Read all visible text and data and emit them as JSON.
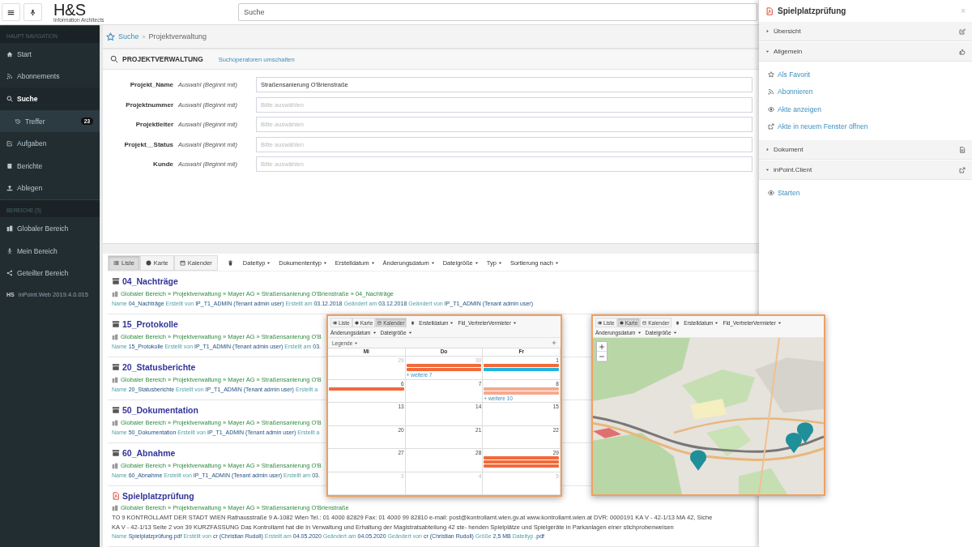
{
  "header": {
    "logo": "H&S",
    "logo_subtitle": "Information Architects",
    "search_placeholder": "Suche"
  },
  "sidebar": {
    "sections": [
      {
        "title": "HAUPT NAVIGATION",
        "items": [
          {
            "label": "Start",
            "selected": false
          },
          {
            "label": "Abonnements",
            "selected": false
          },
          {
            "label": "Suche",
            "selected": true,
            "children": [
              {
                "label": "Treffer",
                "selected": false,
                "badge": "23"
              }
            ]
          },
          {
            "label": "Aufgaben",
            "selected": false
          },
          {
            "label": "Berichte",
            "selected": false
          },
          {
            "label": "Ablegen",
            "selected": false
          }
        ]
      },
      {
        "title": "BEREICHE (5)",
        "items": [
          {
            "label": "Globaler Bereich",
            "selected": false
          },
          {
            "label": "Mein Bereich",
            "selected": false
          },
          {
            "label": "Geteilter Bereich",
            "selected": false
          }
        ]
      }
    ],
    "footer_logo": "HS",
    "version": "inPoint.Web 2019.4.0.015"
  },
  "breadcrumb": {
    "link": "Suche",
    "separator": "»",
    "current": "Projektverwaltung"
  },
  "search_panel": {
    "title": "PROJEKTVERWALTUNG",
    "toggle_link": "Suchoperatoren umschalten",
    "fields": [
      {
        "label": "Projekt_Name",
        "operator": "Auswahl (Beginnt mit)",
        "value": "Straßensanierung O'Brienstraße"
      },
      {
        "label": "Projektnummer",
        "operator": "Auswahl (Beginnt mit)",
        "placeholder": "Bitte auswählen"
      },
      {
        "label": "Projektleiter",
        "operator": "Auswahl (Beginnt mit)",
        "placeholder": "Bitte auswählen"
      },
      {
        "label": "Projekt__Status",
        "operator": "Auswahl (Beginnt mit)",
        "placeholder": "Bitte auswählen"
      },
      {
        "label": "Kunde",
        "operator": "Auswahl (Beginnt mit)",
        "placeholder": "Bitte auswählen"
      }
    ]
  },
  "results_toolbar": {
    "views": [
      {
        "label": "Liste",
        "selected": true
      },
      {
        "label": "Karte",
        "selected": false
      },
      {
        "label": "Kalender",
        "selected": false
      }
    ],
    "filters": [
      "Dateityp",
      "Dokumententyp",
      "Erstelldatum",
      "Änderungsdatum",
      "Dateigröße",
      "Typ",
      "Sortierung nach"
    ]
  },
  "results": [
    {
      "kind": "folder",
      "title": "04_Nachträge",
      "path": "Globaler Bereich » Projektverwaltung » Mayer AG » Straßensanierung O'Brienstraße » 04_Nachträge",
      "meta": [
        {
          "key": "Name",
          "value": "04_Nachträge"
        },
        {
          "key": "Erstellt von",
          "value": "IP_T1_ADMIN (Tenant admin user)"
        },
        {
          "key": "Erstellt am",
          "value": "03.12.2018"
        },
        {
          "key": "Geändert am",
          "value": "03.12.2018"
        },
        {
          "key": "Geändert von",
          "value": "IP_T1_ADMIN (Tenant admin user)"
        }
      ]
    },
    {
      "kind": "folder",
      "title": "15_Protokolle",
      "path": "Globaler Bereich » Projektverwaltung » Mayer AG » Straßensanierung O'B",
      "meta": [
        {
          "key": "Name",
          "value": "15_Protokolle"
        },
        {
          "key": "Erstellt von",
          "value": "IP_T1_ADMIN (Tenant admin user)"
        },
        {
          "key": "Erstellt am",
          "value": "03."
        }
      ]
    },
    {
      "kind": "folder",
      "title": "20_Statusberichte",
      "path": "Globaler Bereich » Projektverwaltung » Mayer AG » Straßensanierung O'B",
      "meta": [
        {
          "key": "Name",
          "value": "20_Statusberichte"
        },
        {
          "key": "Erstellt von",
          "value": "IP_T1_ADMIN (Tenant admin user)"
        },
        {
          "key": "Erstellt a"
        }
      ]
    },
    {
      "kind": "folder",
      "title": "50_Dokumentation",
      "path": "Globaler Bereich » Projektverwaltung » Mayer AG » Straßensanierung O'B",
      "meta": [
        {
          "key": "Name",
          "value": "50_Dokumentation"
        },
        {
          "key": "Erstellt von",
          "value": "IP_T1_ADMIN (Tenant admin user)"
        },
        {
          "key": "Erstellt a"
        }
      ]
    },
    {
      "kind": "folder",
      "title": "60_Abnahme",
      "path": "Globaler Bereich » Projektverwaltung » Mayer AG » Straßensanierung O'B",
      "meta": [
        {
          "key": "Name",
          "value": "60_Abnahme"
        },
        {
          "key": "Erstellt von",
          "value": "IP_T1_ADMIN (Tenant admin user)"
        },
        {
          "key": "Erstellt am",
          "value": "03."
        }
      ]
    },
    {
      "kind": "pdf",
      "title": "Spielplatzprüfung",
      "path": "Globaler Bereich » Projektverwaltung » Mayer AG » Straßensanierung O'Brienstraße",
      "snippet_lines": [
        "TO 9 KONTROLLAMT DER STADT WIEN Rathausstraße 9 A-1082 Wien Tel.: 01 4000 82829 Fax: 01 4000 99 82810 e-mail: post@kontrollamt.wien.gv.at www.kontrollamt.wien.at DVR: 0000191 KA V - 42-1/13 MA 42, Siche",
        "KA V - 42-1/13 Seite 2 von 39 KURZFASSUNG Das Kontrollamt hat die in Verwaltung und Erhaltung der Magistratsabteilung 42 ste- henden Spielplätze und Spielgeräte in Parkanlagen einer stichprobenweisen"
      ],
      "meta": [
        {
          "key": "Name",
          "value": "Spielplatzprüfung.pdf"
        },
        {
          "key": "Erstellt von",
          "value": "cr (Christian Rudoll)"
        },
        {
          "key": "Erstellt am",
          "value": "04.05.2020"
        },
        {
          "key": "Geändert am",
          "value": "04.05.2020"
        },
        {
          "key": "Geändert von",
          "value": "cr (Christian Rudoll)"
        },
        {
          "key": "Größe",
          "value": "2,5 MB"
        },
        {
          "key": "Dateityp",
          "value": ".pdf"
        }
      ]
    }
  ],
  "calendar_preview": {
    "views": [
      {
        "label": "Liste",
        "selected": false
      },
      {
        "label": "Karte",
        "selected": false
      },
      {
        "label": "Kalender",
        "selected": true
      }
    ],
    "filters": [
      "Erstelldatum",
      "Fld_VertreterVermieter",
      "Änderungsdatum",
      "Dateigröße"
    ],
    "legend": "Legende",
    "days": [
      "Mi",
      "Do",
      "Fr"
    ],
    "weeks": [
      [
        {
          "day": "29",
          "muted": true
        },
        {
          "day": "30",
          "muted": true,
          "events": [
            {
              "color": "#f26a3b"
            },
            {
              "color": "#f26a3b"
            }
          ],
          "more": "+ weitere 7"
        },
        {
          "day": "1",
          "muted": false,
          "events": [
            {
              "color": "#f26a3b"
            },
            {
              "color": "#22b5de"
            }
          ]
        }
      ],
      [
        {
          "day": "6",
          "muted": false,
          "events": [
            {
              "color": "#f26a3b"
            }
          ]
        },
        {
          "day": "7",
          "muted": false
        },
        {
          "day": "8",
          "muted": false,
          "events": [
            {
              "color": "#f6a98e"
            },
            {
              "color": "#f6a98e"
            }
          ],
          "more": "+ weitere 10"
        }
      ],
      [
        {
          "day": "13",
          "muted": false
        },
        {
          "day": "14",
          "muted": false
        },
        {
          "day": "15",
          "muted": false
        }
      ],
      [
        {
          "day": "20",
          "muted": false
        },
        {
          "day": "21",
          "muted": false
        },
        {
          "day": "22",
          "muted": false
        }
      ],
      [
        {
          "day": "27",
          "muted": false
        },
        {
          "day": "28",
          "muted": false
        },
        {
          "day": "29",
          "muted": false,
          "events": [
            {
              "color": "#f26a3b"
            },
            {
              "color": "#f26a3b"
            },
            {
              "color": "#f26a3b"
            }
          ]
        }
      ],
      [
        {
          "day": "3",
          "muted": true
        },
        {
          "day": "4",
          "muted": true
        },
        {
          "day": "5",
          "muted": true
        }
      ]
    ]
  },
  "map_preview": {
    "views": [
      {
        "label": "Liste",
        "selected": false
      },
      {
        "label": "Karte",
        "selected": true
      },
      {
        "label": "Kalender",
        "selected": false
      }
    ],
    "filters": [
      "Erstelldatum",
      "Fld_VertreterVermieter",
      "Änderungsdatum",
      "Dateigröße"
    ],
    "map": {
      "kind": "picture"
    }
  },
  "detail_panel": {
    "title": "Spielplatzprüfung",
    "close": "×",
    "sections": [
      {
        "label": "Übersicht",
        "expanded": false
      },
      {
        "label": "Allgemein",
        "expanded": true,
        "items": [
          "Als Favorit",
          "Abonnieren",
          "Akte anzeigen",
          "Akte in neuem Fenster öffnen"
        ]
      },
      {
        "label": "Dokument",
        "expanded": false
      },
      {
        "label": "inPoint.Client",
        "expanded": true,
        "items": [
          "Starten"
        ]
      }
    ]
  }
}
